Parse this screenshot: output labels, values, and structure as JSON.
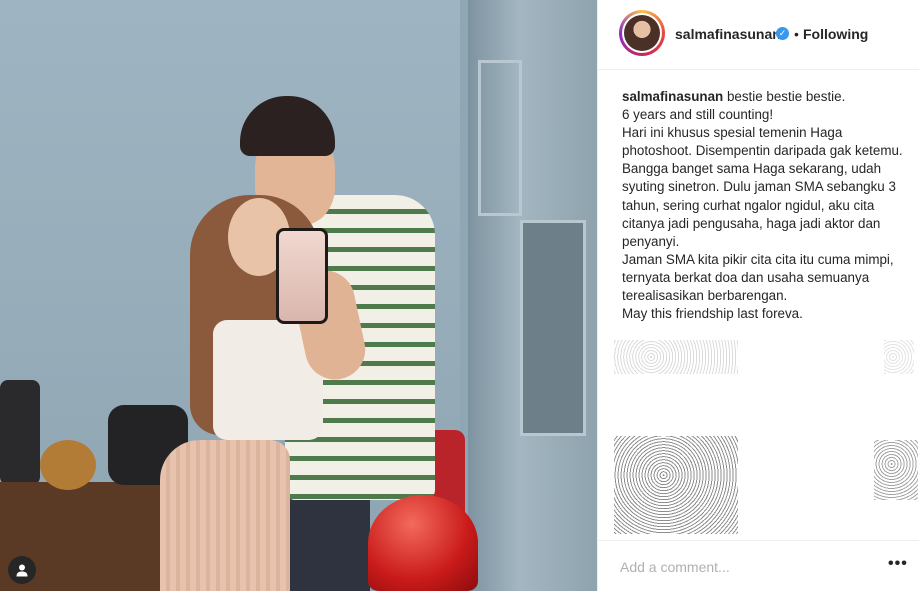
{
  "post": {
    "username": "salmafinasunan",
    "separator": "•",
    "follow_status": "Following",
    "verified_icon": "check-badge-icon",
    "caption": {
      "username": "salmafinasunan",
      "lines": [
        "bestie bestie bestie.",
        "6 years and still counting!",
        "Hari ini khusus spesial temenin Haga photoshoot. Disempentin daripada gak ketemu.",
        "Bangga banget sama Haga sekarang, udah syuting sinetron. Dulu jaman SMA sebangku 3 tahun, sering curhat ngalor ngidul, aku cita citanya jadi pengusaha, haga jadi aktor dan penyanyi.",
        "Jaman SMA kita pikir cita cita itu cuma mimpi, ternyata berkat doa dan usaha semuanya terealisasikan berbarengan.",
        "May this friendship last foreva."
      ]
    },
    "comment": {
      "placeholder": "Add a comment...",
      "more_label": "•••"
    }
  },
  "colors": {
    "accent": "#3897f0",
    "text": "#262626",
    "divider": "#efefef"
  }
}
